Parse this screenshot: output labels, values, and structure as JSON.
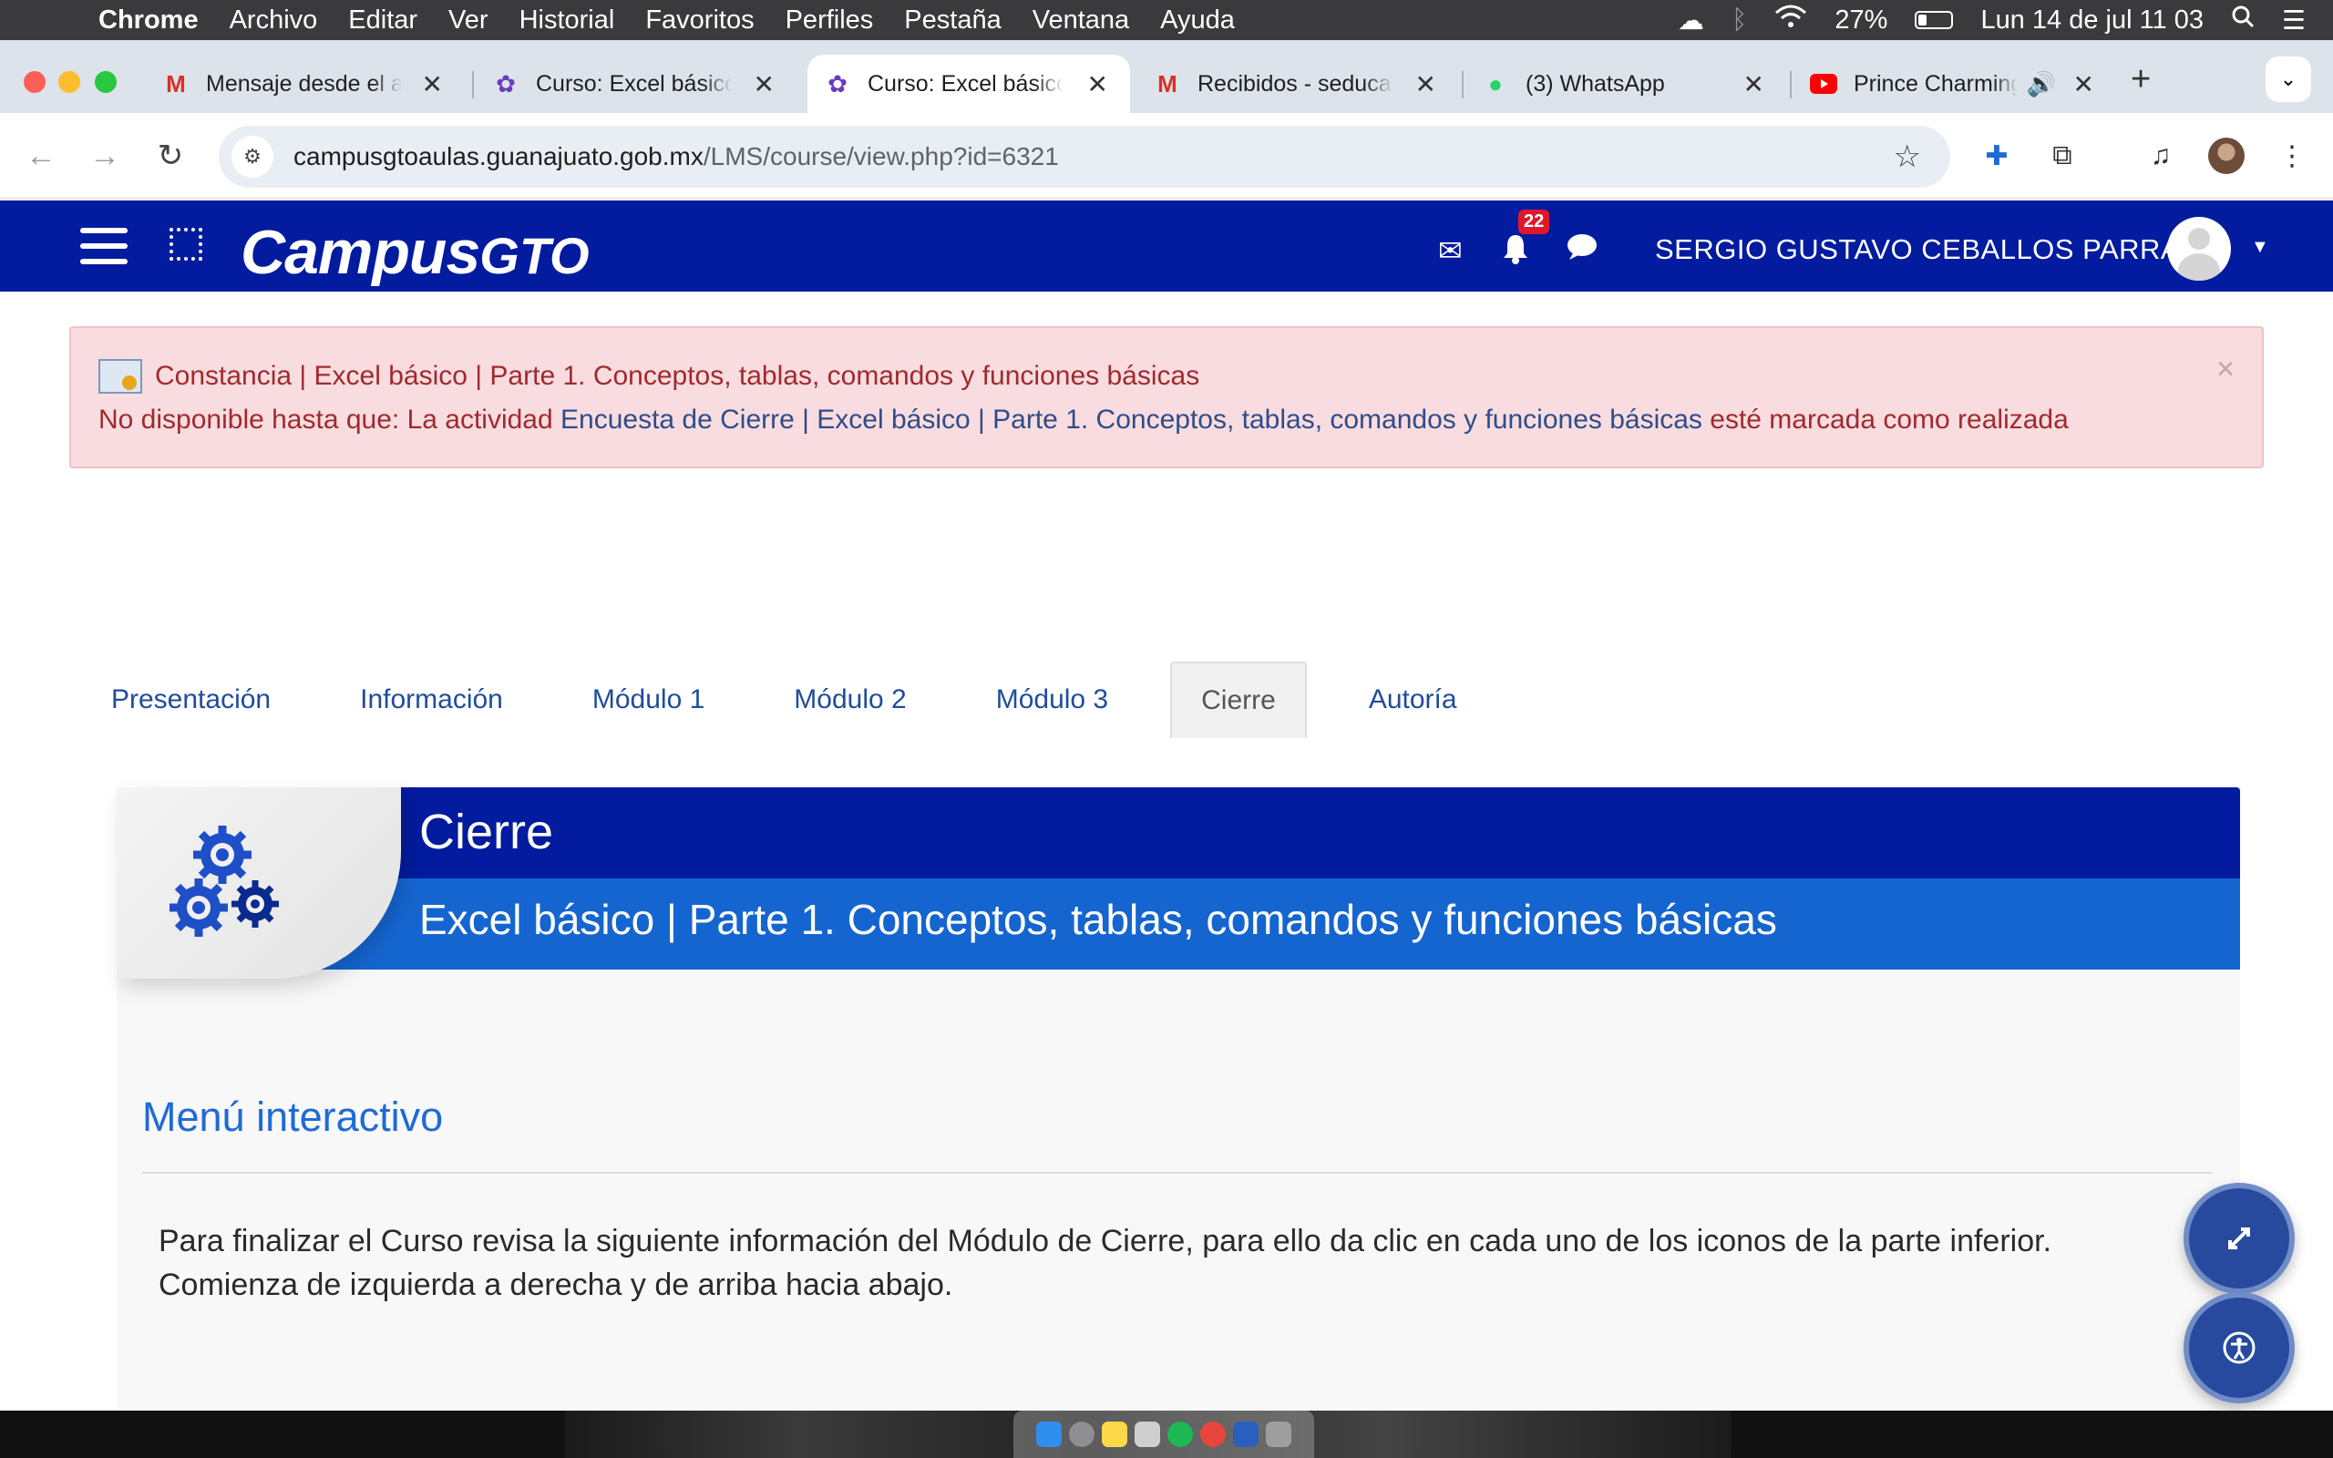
{
  "menubar": {
    "apple": "",
    "app": "Chrome",
    "items": [
      "Archivo",
      "Editar",
      "Ver",
      "Historial",
      "Favoritos",
      "Perfiles",
      "Pestaña",
      "Ventana",
      "Ayuda"
    ],
    "battery": "27%",
    "battery_level": 0.27,
    "datetime": "Lun 14 de jul  11 03"
  },
  "browser": {
    "tabs": [
      {
        "title": "Mensaje desde el a",
        "icon": "gmail-icon"
      },
      {
        "title": "Curso: Excel básico",
        "icon": "moodle-icon"
      },
      {
        "title": "Curso: Excel básico",
        "icon": "moodle-icon",
        "active": true
      },
      {
        "title": "Recibidos - seduca",
        "icon": "gmail-icon"
      },
      {
        "title": "(3) WhatsApp",
        "icon": "whatsapp-icon"
      },
      {
        "title": "Prince Charming",
        "icon": "youtube-icon"
      }
    ],
    "url_host": "campusgtoaulas.guanajuato.gob.mx",
    "url_path": "/LMS/course/view.php?id=6321"
  },
  "site": {
    "logo_main": "Campus",
    "logo_suffix": "GTO",
    "notification_count": "22",
    "user_name": "SERGIO GUSTAVO CEBALLOS PARRA"
  },
  "alert": {
    "title": "Constancia | Excel básico | Parte 1. Conceptos, tablas, comandos y funciones básicas",
    "prefix": "No disponible hasta que: La actividad ",
    "link": "Encuesta de Cierre | Excel básico | Parte 1. Conceptos, tablas, comandos y funciones básicas",
    "suffix": " esté marcada como realizada",
    "close": "×"
  },
  "course_tabs": [
    "Presentación",
    "Información",
    "Módulo 1",
    "Módulo 2",
    "Módulo 3",
    "Cierre",
    "Autoría"
  ],
  "section": {
    "title": "Cierre",
    "subtitle": "Excel básico | Parte 1. Conceptos, tablas, comandos y funciones básicas",
    "menu_heading": "Menú interactivo",
    "intro_line1": "Para finalizar el Curso revisa la siguiente información del Módulo de Cierre, para ello da clic en cada uno de los iconos de la parte inferior.",
    "intro_line2": "Comienza de izquierda a derecha y de arriba hacia abajo."
  },
  "colors": {
    "header": "#031b9e",
    "banner_light": "#1565d0",
    "alert_bg": "#f8dcdf",
    "alert_text": "#a02a2f",
    "link": "#214c9b"
  }
}
